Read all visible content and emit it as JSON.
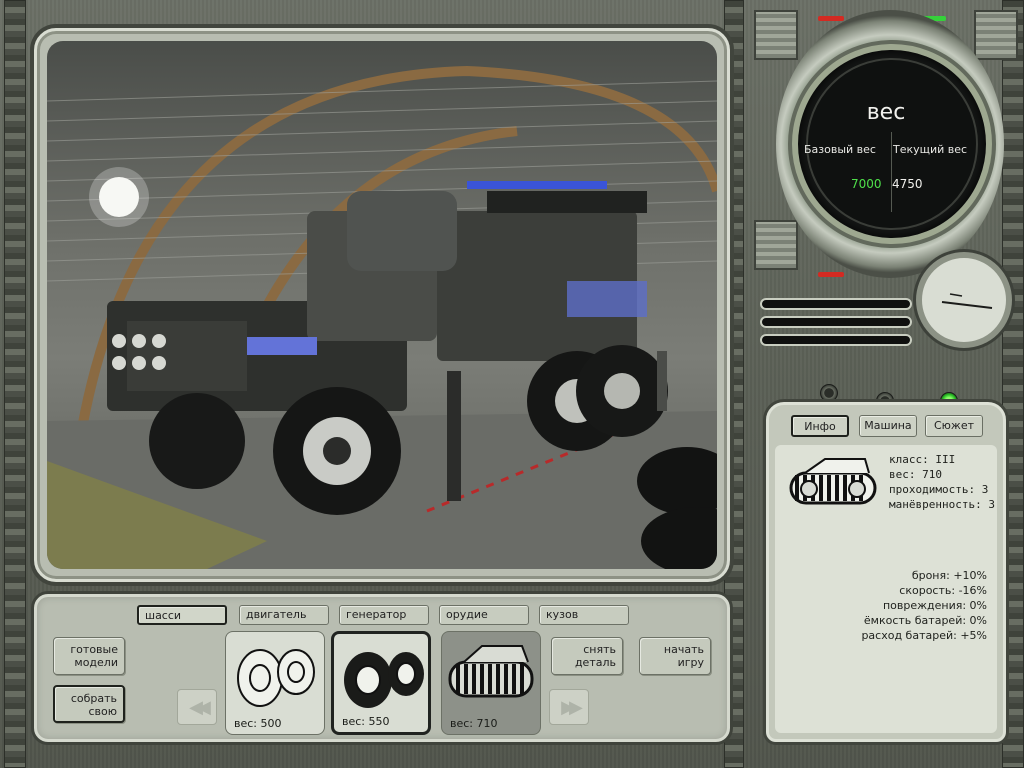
{
  "gauge": {
    "title": "вес",
    "base_label": "Базовый вес",
    "current_label": "Текущий вес",
    "base_value": "7000",
    "current_value": "4750",
    "base_color": "#4fe04a",
    "current_color": "#f0f0ec"
  },
  "part_tabs": [
    {
      "label": "шасси",
      "active": true
    },
    {
      "label": "двигатель",
      "active": false
    },
    {
      "label": "генератор",
      "active": false
    },
    {
      "label": "орудие",
      "active": false
    },
    {
      "label": "кузов",
      "active": false
    }
  ],
  "side_buttons": {
    "ready_models": [
      "готовые",
      "модели"
    ],
    "build_own": [
      "собрать",
      "свою"
    ],
    "remove_part": [
      "снять",
      "деталь"
    ],
    "start_game": [
      "начать",
      "игру"
    ]
  },
  "part_cards": [
    {
      "weight": "вес: 500",
      "icon": "wheels-icon",
      "selected": false,
      "style": "light"
    },
    {
      "weight": "вес: 550",
      "icon": "tire-wheels-icon",
      "selected": true,
      "style": "light"
    },
    {
      "weight": "вес: 710",
      "icon": "tracks-icon",
      "selected": false,
      "style": "gray"
    }
  ],
  "info_tabs": [
    {
      "label": "Инфо",
      "active": true
    },
    {
      "label": "Машина",
      "active": false
    },
    {
      "label": "Сюжет",
      "active": false
    }
  ],
  "info": {
    "specs": [
      "класс: III",
      "вес: 710",
      "проходимость: 3",
      "манёвренность: 3"
    ],
    "mods": [
      "броня: +10%",
      "скорость: -16%",
      "повреждения: 0%",
      "ёмкость батарей: 0%",
      "расход батарей: +5%"
    ],
    "icon": "tracks-icon"
  },
  "indicators": {
    "led_red": "#d42a22",
    "led_green": "#35d23a",
    "status_light_on": true
  }
}
